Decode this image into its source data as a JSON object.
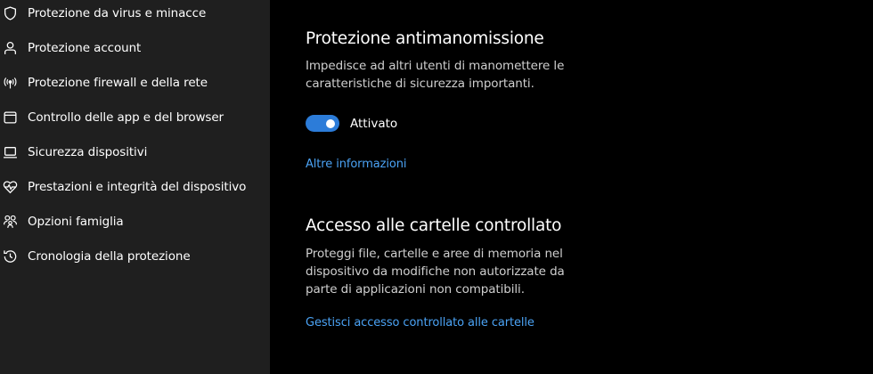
{
  "sidebar": {
    "items": [
      {
        "label": "Protezione da virus e minacce",
        "icon": "shield-icon"
      },
      {
        "label": "Protezione account",
        "icon": "person-icon"
      },
      {
        "label": "Protezione firewall e della rete",
        "icon": "wireless-antenna-icon"
      },
      {
        "label": "Controllo delle app e del browser",
        "icon": "app-window-icon"
      },
      {
        "label": "Sicurezza dispositivi",
        "icon": "laptop-icon"
      },
      {
        "label": "Prestazioni e integrità del dispositivo",
        "icon": "heart-pulse-icon"
      },
      {
        "label": "Opzioni famiglia",
        "icon": "family-icon"
      },
      {
        "label": "Cronologia della protezione",
        "icon": "history-icon"
      }
    ]
  },
  "tamper_protection": {
    "title": "Protezione antimanomissione",
    "description": "Impedisce ad altri utenti di manomettere le caratteristiche di sicurezza importanti.",
    "toggle_state": "on",
    "toggle_label": "Attivato",
    "link": "Altre informazioni"
  },
  "controlled_folder_access": {
    "title": "Accesso alle cartelle controllato",
    "description": "Proteggi file, cartelle e aree di memoria nel dispositivo da modifiche non autorizzate da parte di applicazioni non compatibili.",
    "link": "Gestisci accesso controllato alle cartelle"
  },
  "colors": {
    "sidebar_background": "#1f1f1f",
    "main_background": "#000000",
    "accent": "#2c7cd9",
    "link": "#4ba3f5"
  }
}
